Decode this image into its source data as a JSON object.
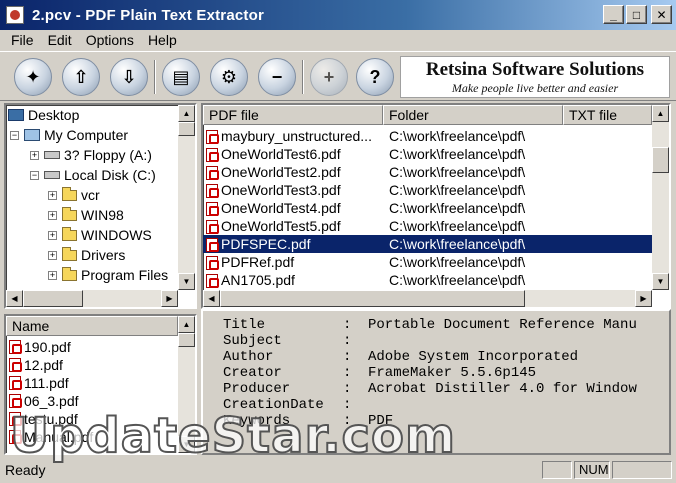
{
  "window": {
    "title": "2.pcv - PDF Plain Text Extractor",
    "minimize": "_",
    "maximize": "□",
    "close": "✕"
  },
  "menu": [
    "File",
    "Edit",
    "Options",
    "Help"
  ],
  "toolbar": {
    "buttons": [
      {
        "name": "new-icon",
        "glyph": "✦"
      },
      {
        "name": "open-icon",
        "glyph": "⇧"
      },
      {
        "name": "save-icon",
        "glyph": "⇩"
      },
      {
        "name": "extract-icon",
        "glyph": "▤"
      },
      {
        "name": "settings-icon",
        "glyph": "⚙"
      },
      {
        "name": "remove-icon",
        "glyph": "−"
      },
      {
        "name": "add-icon",
        "glyph": "+"
      },
      {
        "name": "help-icon",
        "glyph": "?"
      }
    ],
    "logo_title": "Retsina Software Solutions",
    "logo_tagline": "Make people live better and easier"
  },
  "tree": {
    "items": [
      {
        "label": "Desktop",
        "icon": "desktop-icon"
      },
      {
        "label": "My Computer",
        "icon": "computer-icon",
        "expander": "−"
      },
      {
        "label": "3? Floppy (A:)",
        "icon": "floppy-icon",
        "expander": "+"
      },
      {
        "label": "Local Disk (C:)",
        "icon": "drive-icon",
        "expander": "−"
      },
      {
        "label": "vcr",
        "icon": "folder-icon",
        "expander": "+"
      },
      {
        "label": "WIN98",
        "icon": "folder-icon",
        "expander": "+"
      },
      {
        "label": "WINDOWS",
        "icon": "folder-icon",
        "expander": "+"
      },
      {
        "label": "Drivers",
        "icon": "folder-icon",
        "expander": "+"
      },
      {
        "label": "Program Files",
        "icon": "folder-icon",
        "expander": "+"
      }
    ]
  },
  "names_list": {
    "header": "Name",
    "items": [
      "190.pdf",
      "12.pdf",
      "111.pdf",
      "06_3.pdf",
      "testu.pdf",
      "Manual.pdf"
    ]
  },
  "file_list": {
    "columns": [
      "PDF file",
      "Folder",
      "TXT file"
    ],
    "rows": [
      {
        "file": "maybury_unstructured...",
        "folder": "C:\\work\\freelance\\pdf\\",
        "txt": ""
      },
      {
        "file": "OneWorldTest6.pdf",
        "folder": "C:\\work\\freelance\\pdf\\",
        "txt": ""
      },
      {
        "file": "OneWorldTest2.pdf",
        "folder": "C:\\work\\freelance\\pdf\\",
        "txt": ""
      },
      {
        "file": "OneWorldTest3.pdf",
        "folder": "C:\\work\\freelance\\pdf\\",
        "txt": ""
      },
      {
        "file": "OneWorldTest4.pdf",
        "folder": "C:\\work\\freelance\\pdf\\",
        "txt": ""
      },
      {
        "file": "OneWorldTest5.pdf",
        "folder": "C:\\work\\freelance\\pdf\\",
        "txt": ""
      },
      {
        "file": "PDFSPEC.pdf",
        "folder": "C:\\work\\freelance\\pdf\\",
        "txt": "",
        "selected": true
      },
      {
        "file": "PDFRef.pdf",
        "folder": "C:\\work\\freelance\\pdf\\",
        "txt": ""
      },
      {
        "file": "AN1705.pdf",
        "folder": "C:\\work\\freelance\\pdf\\",
        "txt": ""
      }
    ]
  },
  "properties": [
    {
      "label": "Title",
      "value": "Portable Document Reference Manu"
    },
    {
      "label": "Subject",
      "value": ""
    },
    {
      "label": "Author",
      "value": "Adobe System Incorporated"
    },
    {
      "label": "Creator",
      "value": "FrameMaker 5.5.6p145"
    },
    {
      "label": "Producer",
      "value": "Acrobat Distiller 4.0 for Window"
    },
    {
      "label": "CreationDate",
      "value": ""
    },
    {
      "label": "Keywords",
      "value": "PDF"
    }
  ],
  "watermark": "UpdateStar.com",
  "status": {
    "text": "Ready",
    "num": "NUM"
  }
}
